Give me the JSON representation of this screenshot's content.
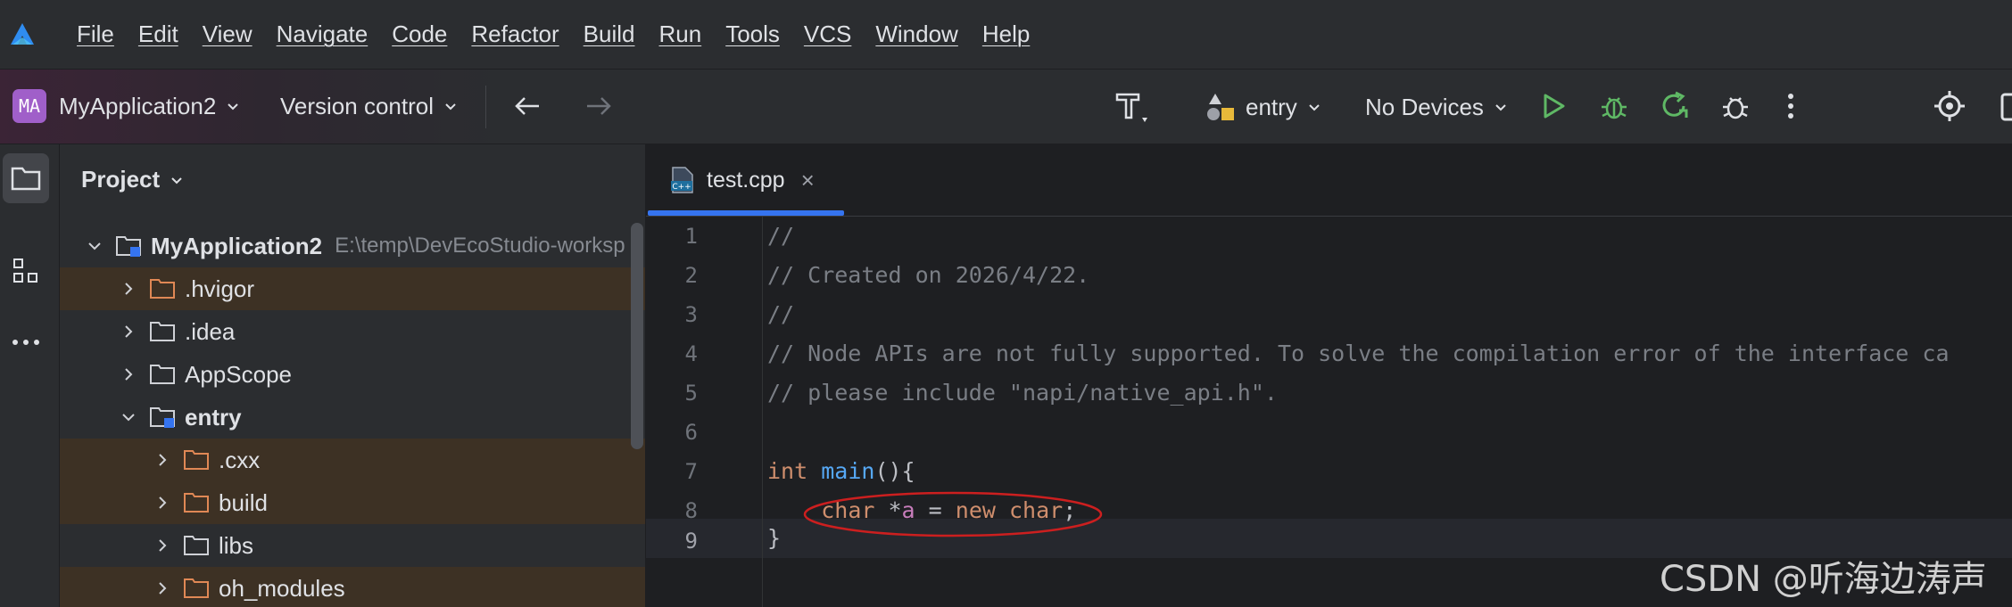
{
  "menubar": {
    "items": [
      "File",
      "Edit",
      "View",
      "Navigate",
      "Code",
      "Refactor",
      "Build",
      "Run",
      "Tools",
      "VCS",
      "Window",
      "Help"
    ]
  },
  "toolbar": {
    "project_initials": "MA",
    "project_name": "MyApplication2",
    "version_control": "Version control",
    "run_config": "entry",
    "device": "No Devices"
  },
  "project_panel": {
    "title": "Project",
    "tree": [
      {
        "label": "MyApplication2",
        "path": "E:\\temp\\DevEcoStudio-worksp",
        "expanded": true,
        "module": true
      },
      {
        "label": ".hvigor",
        "expanded": false,
        "highlight": true
      },
      {
        "label": ".idea",
        "expanded": false
      },
      {
        "label": "AppScope",
        "expanded": false
      },
      {
        "label": "entry",
        "expanded": true,
        "module": true
      },
      {
        "label": ".cxx",
        "expanded": false,
        "highlight": true
      },
      {
        "label": "build",
        "expanded": false,
        "highlight": true
      },
      {
        "label": "libs",
        "expanded": false
      },
      {
        "label": "oh_modules",
        "expanded": false,
        "highlight": true
      }
    ]
  },
  "editor": {
    "tab": {
      "name": "test.cpp",
      "close": "×",
      "icon_text": "C++"
    },
    "line_numbers": [
      "1",
      "2",
      "3",
      "4",
      "5",
      "6",
      "7",
      "8",
      "9"
    ],
    "lines": [
      "//",
      "// Created on 2026/4/22.",
      "//",
      "// Node APIs are not fully supported. To solve the compilation error of the interface ca",
      "// please include \"napi/native_api.h\".",
      "",
      "int main(){",
      "    char *a = new char;",
      "}"
    ],
    "current_line": "9",
    "annotation_color": "#cc1f1f"
  },
  "watermark": "CSDN @听海边涛声",
  "colors": {
    "accent": "#3574f0",
    "run_green": "#5fb865",
    "keyword": "#cf8e6d",
    "function": "#56a8f5",
    "comment": "#7a7e85"
  }
}
